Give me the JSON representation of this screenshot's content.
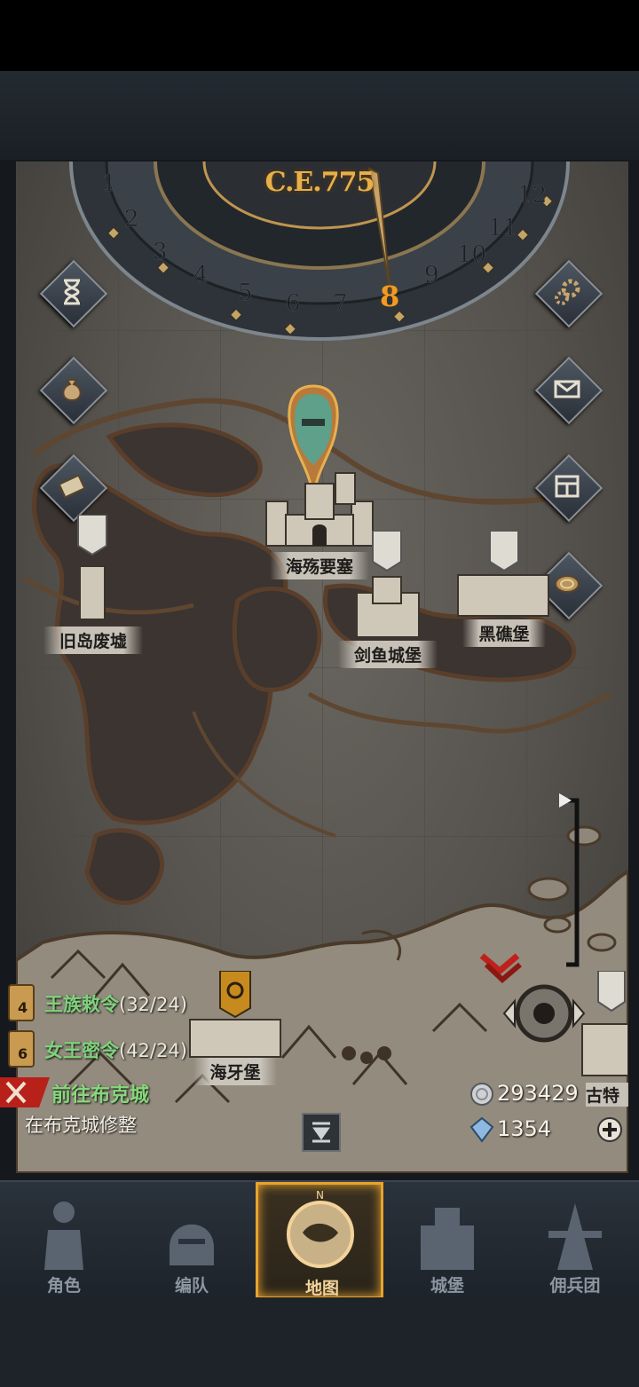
{
  "calendar": {
    "year": "C.E.775",
    "months": [
      "1",
      "2",
      "3",
      "4",
      "5",
      "6",
      "7",
      "8",
      "9",
      "10",
      "11",
      "12"
    ],
    "current_month": "8"
  },
  "side_buttons": {
    "left": [
      "hourglass-icon",
      "money-bag-icon",
      "scroll-map-icon"
    ],
    "right": [
      "gear-icon",
      "mail-icon",
      "ledger-icon",
      "coin-icon"
    ]
  },
  "places": {
    "hai_shang": "海殇要塞",
    "jiu_dao": "旧岛废墟",
    "jian_yu": "剑鱼城堡",
    "hei_jiao": "黑礁堡",
    "hai_ya": "海牙堡",
    "gu_te": "古特"
  },
  "quests": [
    {
      "badge": "4",
      "title": "王族敕令",
      "count": "(32/24)"
    },
    {
      "badge": "6",
      "title": "女王密令",
      "count": "(42/24)"
    }
  ],
  "travel": {
    "label": "前往布克城",
    "status": "在布克城修整"
  },
  "resources": {
    "silver": "293429",
    "gems": "1354"
  },
  "nav": {
    "tabs": [
      {
        "label": "角色",
        "icon": "knight-icon"
      },
      {
        "label": "编队",
        "icon": "helmet-icon"
      },
      {
        "label": "地图",
        "icon": "compass-map-icon"
      },
      {
        "label": "城堡",
        "icon": "castle-icon"
      },
      {
        "label": "佣兵团",
        "icon": "mercenary-icon"
      }
    ],
    "compass_letter": "N"
  },
  "colors": {
    "accent": "#e8a32e",
    "quest_green": "#7fd27c",
    "year_gold": "#e8b04a"
  }
}
